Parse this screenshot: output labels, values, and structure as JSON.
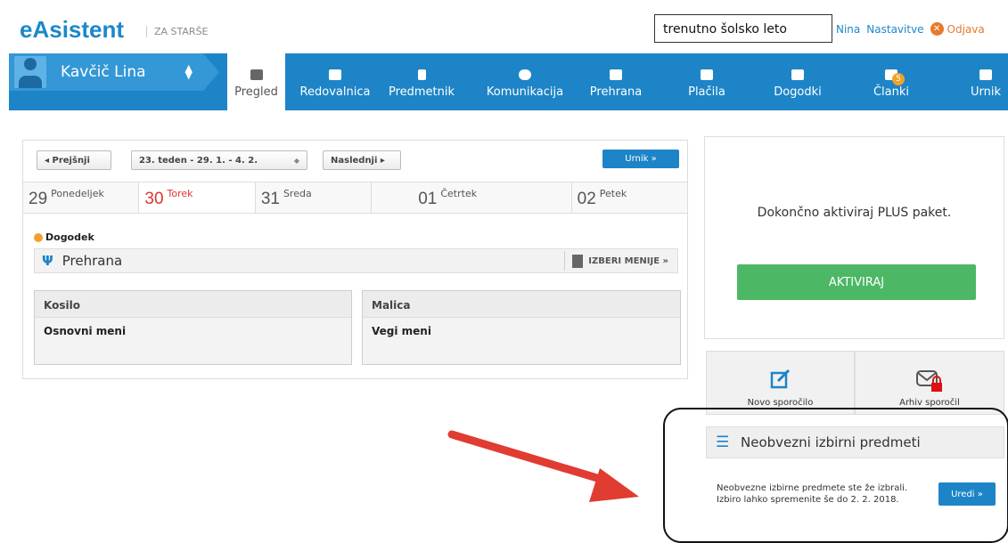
{
  "header": {
    "logo": "eAsistent",
    "logo_sub": "ZA STARŠE",
    "year_select": "trenutno šolsko leto",
    "user": "Nina",
    "settings": "Nastavitve",
    "logout": "Odjava"
  },
  "student": {
    "name": "Kavčič Lina"
  },
  "nav": [
    {
      "label": "Pregled",
      "icon": "cube-icon"
    },
    {
      "label": "Redovalnica",
      "icon": "gradebook-icon"
    },
    {
      "label": "Predmetnik",
      "icon": "book-icon"
    },
    {
      "label": "Komunikacija",
      "icon": "chat-icon"
    },
    {
      "label": "Prehrana",
      "icon": "food-icon"
    },
    {
      "label": "Plačila",
      "icon": "card-icon"
    },
    {
      "label": "Dogodki",
      "icon": "card-icon"
    },
    {
      "label": "Članki",
      "icon": "article-icon",
      "badge": "5"
    },
    {
      "label": "Urnik",
      "icon": "calendar-icon"
    }
  ],
  "week": {
    "prev": "Prejšnji",
    "current": "23. teden - 29. 1. - 4. 2.",
    "next": "Naslednji",
    "timetable_btn": "Urnik »"
  },
  "days": [
    {
      "num": "29",
      "name": "Ponedeljek"
    },
    {
      "num": "30",
      "name": "Torek"
    },
    {
      "num": "31",
      "name": "Sreda"
    },
    {
      "num": "01",
      "name": "Četrtek"
    },
    {
      "num": "02",
      "name": "Petek"
    }
  ],
  "event_label": "Dogodek",
  "meals": {
    "title": "Prehrana",
    "choose_btn": "IZBERI MENIJE »",
    "lunch": {
      "title": "Kosilo",
      "menu": "Osnovni meni"
    },
    "snack": {
      "title": "Malica",
      "menu": "Vegi meni"
    }
  },
  "plus": {
    "text": "Dokončno aktiviraj PLUS paket.",
    "button": "AKTIVIRAJ"
  },
  "messages": {
    "new": "Novo sporočilo",
    "archive": "Arhiv sporočil"
  },
  "electives": {
    "title": "Neobvezni izbirni predmeti",
    "text": "Neobvezne izbirne predmete ste že izbrali. Izbiro lahko spremenite še do 2. 2. 2018.",
    "button": "Uredi »"
  },
  "colors": {
    "primary": "#1d84c7",
    "accent_green": "#4cb865",
    "today_red": "#dd3333",
    "arrow_red": "#e03c31"
  }
}
